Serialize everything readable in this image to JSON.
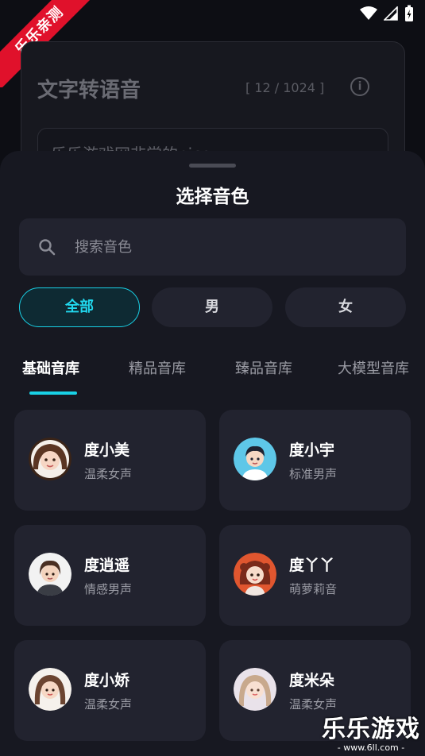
{
  "watermark_ribbon": "乐乐亲测",
  "background_panel": {
    "title": "文字转语音",
    "char_count": "[ 12 / 1024 ]",
    "info_icon": "info-icon",
    "text_preview": "乐乐游戏网非常的nice"
  },
  "sheet": {
    "title": "选择音色",
    "search": {
      "placeholder": "搜索音色",
      "value": ""
    },
    "filters": [
      {
        "label": "全部",
        "active": true
      },
      {
        "label": "男",
        "active": false
      },
      {
        "label": "女",
        "active": false
      }
    ],
    "tabs": [
      {
        "label": "基础音库",
        "active": true
      },
      {
        "label": "精品音库",
        "active": false
      },
      {
        "label": "臻品音库",
        "active": false
      },
      {
        "label": "大模型音库",
        "active": false
      }
    ],
    "voices": [
      {
        "name": "度小美",
        "desc": "温柔女声"
      },
      {
        "name": "度小宇",
        "desc": "标准男声"
      },
      {
        "name": "度逍遥",
        "desc": "情感男声"
      },
      {
        "name": "度丫丫",
        "desc": "萌萝莉音"
      },
      {
        "name": "度小娇",
        "desc": "温柔女声"
      },
      {
        "name": "度米朵",
        "desc": "温柔女声"
      }
    ]
  },
  "watermark": {
    "title": "乐乐游戏",
    "url": "- www.6ll.com -"
  },
  "colors": {
    "accent": "#19d1e6",
    "sheet_bg": "#171821",
    "card_bg": "#22232f",
    "ribbon": "#e0112b"
  }
}
